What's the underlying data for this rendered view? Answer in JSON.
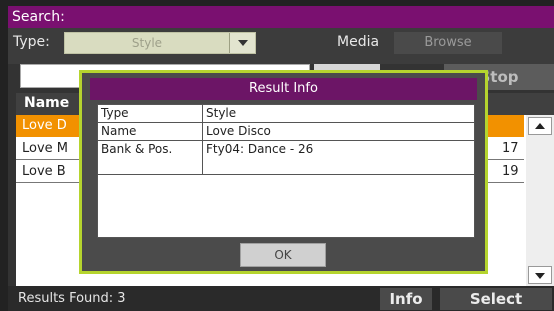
{
  "title": "Search:",
  "toolbar": {
    "type_label": "Type:",
    "type_value": "Style",
    "media_label": "Media",
    "browse_label": "Browse"
  },
  "search": {
    "stop_label": "Stop"
  },
  "results": {
    "header_name": "Name",
    "rows": [
      {
        "name": "Love D",
        "num": "",
        "selected": true
      },
      {
        "name": "Love M",
        "num": "17",
        "selected": false
      },
      {
        "name": "Love B",
        "num": "19",
        "selected": false
      }
    ]
  },
  "status": {
    "results_found": "Results Found:  3",
    "info_label": "Info",
    "select_label": "Select"
  },
  "modal": {
    "title": "Result Info",
    "rows": [
      {
        "key": "Type",
        "value": "Style"
      },
      {
        "key": "Name",
        "value": "Love Disco"
      },
      {
        "key": "Bank & Pos.",
        "value": "Fty04: Dance - 26"
      }
    ],
    "ok_label": "OK"
  },
  "colors": {
    "title_bar": "#7a1070",
    "selection": "#f29100",
    "modal_border": "#b5d42e",
    "modal_title": "#6c1566"
  }
}
